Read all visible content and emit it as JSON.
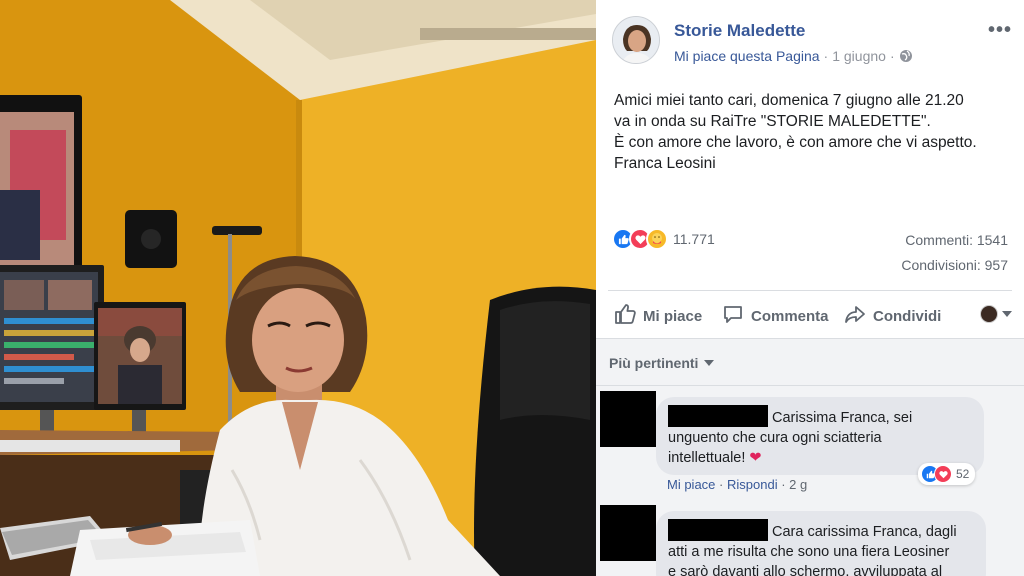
{
  "post": {
    "page_name": "Storie Maledette",
    "like_page": "Mi piace questa Pagina",
    "date": "1 giugno",
    "more_icon": "more-icon",
    "text_lines": [
      "Amici miei tanto cari, domenica 7 giugno alle 21.20",
      "va in onda su RaiTre \"STORIE MALEDETTE\".",
      "È con amore che lavoro, è con amore che vi aspetto.",
      "Franca Leosini"
    ],
    "reaction_count": "11.771",
    "comments_count": "Commenti: 1541",
    "shares_count": "Condivisioni: 957",
    "actions": {
      "like": "Mi piace",
      "comment": "Commenta",
      "share": "Condividi"
    },
    "reactions": [
      "like",
      "love",
      "care"
    ]
  },
  "comments": {
    "sort_label": "Più pertinenti",
    "items": [
      {
        "lines": [
          "Carissima Franca, sei",
          "unguento che cura ogni sciatteria",
          "intellettuale!"
        ],
        "heart": "❤️",
        "react_count": "52",
        "like": "Mi piace",
        "reply": "Rispondi",
        "age": "2 g"
      },
      {
        "lines": [
          "Cara carissima Franca, dagli",
          "atti a me risulta che sono una fiera Leosiner",
          "e sarò davanti allo schermo, avviluppata al"
        ]
      }
    ]
  },
  "colors": {
    "link": "#385898",
    "wall": "#e9a81a",
    "like_blue": "#1877f2",
    "love_red": "#f33e58"
  }
}
